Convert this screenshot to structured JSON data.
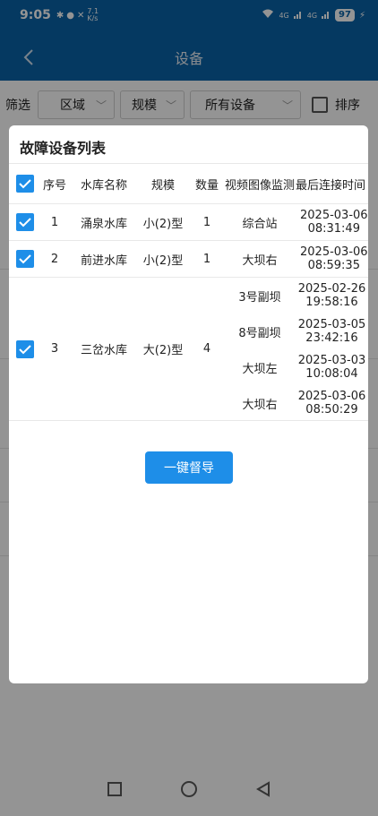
{
  "status": {
    "time": "9:05",
    "net_speed_top": "7.1",
    "net_speed_unit": "K/s",
    "signal1": "4G",
    "signal2": "4G",
    "battery": "97"
  },
  "header": {
    "title": "设备"
  },
  "filter": {
    "label": "筛选",
    "region": "区域",
    "scale": "规模",
    "device": "所有设备",
    "sort": "排序"
  },
  "dialog": {
    "title": "故障设备列表",
    "columns": {
      "no": "序号",
      "name": "水库名称",
      "scale": "规模",
      "count": "数量",
      "video": "视频图像监测",
      "time": "最后连接时间"
    },
    "rows": [
      {
        "no": "1",
        "name": "涌泉水库",
        "scale": "小(2)型",
        "count": "1",
        "devices": [
          {
            "video": "综合站",
            "date": "2025-03-06",
            "clock": "08:31:49"
          }
        ]
      },
      {
        "no": "2",
        "name": "前进水库",
        "scale": "小(2)型",
        "count": "1",
        "devices": [
          {
            "video": "大坝右",
            "date": "2025-03-06",
            "clock": "08:59:35"
          }
        ]
      },
      {
        "no": "3",
        "name": "三岔水库",
        "scale": "大(2)型",
        "count": "4",
        "devices": [
          {
            "video": "3号副坝",
            "date": "2025-02-26",
            "clock": "19:58:16"
          },
          {
            "video": "8号副坝",
            "date": "2025-03-05",
            "clock": "23:42:16"
          },
          {
            "video": "大坝左",
            "date": "2025-03-03",
            "clock": "10:08:04"
          },
          {
            "video": "大坝右",
            "date": "2025-03-06",
            "clock": "08:50:29"
          }
        ]
      }
    ],
    "button": "一键督导"
  },
  "colors": {
    "header": "#0a63a8",
    "primary": "#1e8ee8"
  }
}
